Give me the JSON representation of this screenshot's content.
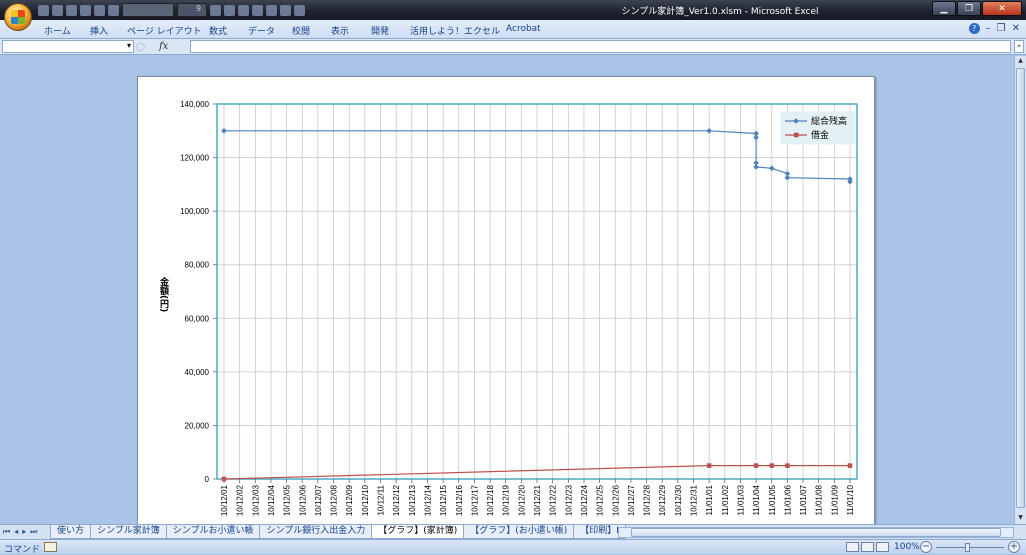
{
  "window": {
    "title": "シンプル家計簿_Ver1.0.xlsm - Microsoft Excel",
    "controls": [
      "minimize",
      "restore",
      "close"
    ],
    "font_size_box": "9"
  },
  "ribbon": {
    "tabs": [
      "ホーム",
      "挿入",
      "ページ レイアウト",
      "数式",
      "データ",
      "校閲",
      "表示",
      "開発",
      "活用しよう！エクセル",
      "Acrobat"
    ]
  },
  "formula_bar": {
    "name_box": "",
    "fx_label": "fx",
    "formula": ""
  },
  "chart_data": {
    "type": "line",
    "title": "",
    "xlabel": "",
    "ylabel": "金額(円)",
    "ylim": [
      0,
      140000
    ],
    "yticks": [
      "0",
      "20,000",
      "40,000",
      "60,000",
      "80,000",
      "100,000",
      "120,000",
      "140,000"
    ],
    "grid": true,
    "legend": "top-right",
    "categories": [
      "10/12/01",
      "10/12/02",
      "10/12/03",
      "10/12/04",
      "10/12/05",
      "10/12/06",
      "10/12/07",
      "10/12/08",
      "10/12/09",
      "10/12/10",
      "10/12/11",
      "10/12/12",
      "10/12/13",
      "10/12/14",
      "10/12/15",
      "10/12/16",
      "10/12/17",
      "10/12/18",
      "10/12/19",
      "10/12/20",
      "10/12/21",
      "10/12/22",
      "10/12/23",
      "10/12/24",
      "10/12/25",
      "10/12/26",
      "10/12/27",
      "10/12/28",
      "10/12/29",
      "10/12/30",
      "10/12/31",
      "11/01/01",
      "11/01/02",
      "11/01/03",
      "11/01/04",
      "11/01/05",
      "11/01/06",
      "11/01/07",
      "11/01/08",
      "11/01/09",
      "11/01/10"
    ],
    "series": [
      {
        "name": "総合残高",
        "color": "#4f81bd",
        "marker": "diamond",
        "points": [
          [
            "10/12/01",
            130000
          ],
          [
            "11/01/01",
            130000
          ],
          [
            "11/01/04",
            129000
          ],
          [
            "11/01/04",
            127500
          ],
          [
            "11/01/04",
            118000
          ],
          [
            "11/01/04",
            116500
          ],
          [
            "11/01/05",
            116000
          ],
          [
            "11/01/06",
            114000
          ],
          [
            "11/01/06",
            112500
          ],
          [
            "11/01/10",
            112000
          ],
          [
            "11/01/10",
            111000
          ]
        ]
      },
      {
        "name": "借金",
        "color": "#c0504d",
        "marker": "square",
        "points": [
          [
            "10/12/01",
            0
          ],
          [
            "11/01/01",
            5000
          ],
          [
            "11/01/04",
            5000
          ],
          [
            "11/01/05",
            5000
          ],
          [
            "11/01/06",
            5000
          ],
          [
            "11/01/10",
            5000
          ]
        ]
      }
    ]
  },
  "sheet_tabs": [
    "使い方",
    "シンプル家計簿",
    "シンプルお小遣い帳",
    "シンプル銀行入出金入力",
    "【グラフ】(家計簿)",
    "【グラフ】(お小遣い帳)",
    "【印刷】I"
  ],
  "active_sheet": 4,
  "status_bar": {
    "mode": "コマンド",
    "zoom": "100%"
  }
}
